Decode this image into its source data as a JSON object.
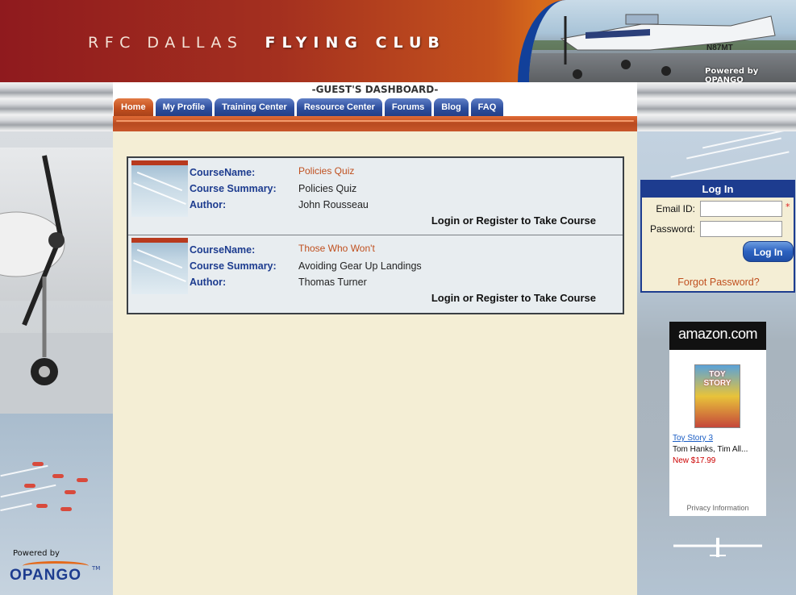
{
  "header": {
    "title_light": "RFC DALLAS",
    "title_bold": "FLYING CLUB",
    "powered_by": "Powered by OPANGO",
    "plane_registration": "N87MT"
  },
  "dashboard": {
    "title": "-GUEST'S DASHBOARD-"
  },
  "nav": {
    "tabs": [
      {
        "label": "Home",
        "active": true
      },
      {
        "label": "My Profile",
        "active": false
      },
      {
        "label": "Training Center",
        "active": false
      },
      {
        "label": "Resource Center",
        "active": false
      },
      {
        "label": "Forums",
        "active": false
      },
      {
        "label": "Blog",
        "active": false
      },
      {
        "label": "FAQ",
        "active": false
      }
    ]
  },
  "courses": {
    "labels": {
      "name": "CourseName:",
      "summary": "Course Summary:",
      "author": "Author:"
    },
    "action_label": "Login or Register to Take Course",
    "items": [
      {
        "name": "Policies Quiz",
        "summary": "Policies Quiz",
        "author": "John Rousseau"
      },
      {
        "name": "Those Who Won't",
        "summary": "Avoiding Gear Up Landings",
        "author": "Thomas Turner"
      }
    ]
  },
  "login": {
    "title": "Log In",
    "email_label": "Email ID:",
    "password_label": "Password:",
    "required_marker": "*",
    "button": "Log In",
    "forgot": "Forgot Password?"
  },
  "ad": {
    "brand": "amazon.com",
    "cover_text": "TOY STORY",
    "product": "Toy Story 3",
    "cast": "Tom Hanks, Tim All...",
    "price": "New $17.99",
    "privacy": "Privacy Information"
  },
  "footer": {
    "powered_by": "Powered by",
    "brand": "OPANGO",
    "tm": "TM"
  },
  "colors": {
    "header_red": "#8f1a1e",
    "header_orange": "#d76a1b",
    "nav_blue": "#2e4f9e",
    "active_tab": "#c3501f",
    "label_blue": "#1d3c8f",
    "link_orange": "#c0501f",
    "content_bg": "#f4eed5"
  }
}
